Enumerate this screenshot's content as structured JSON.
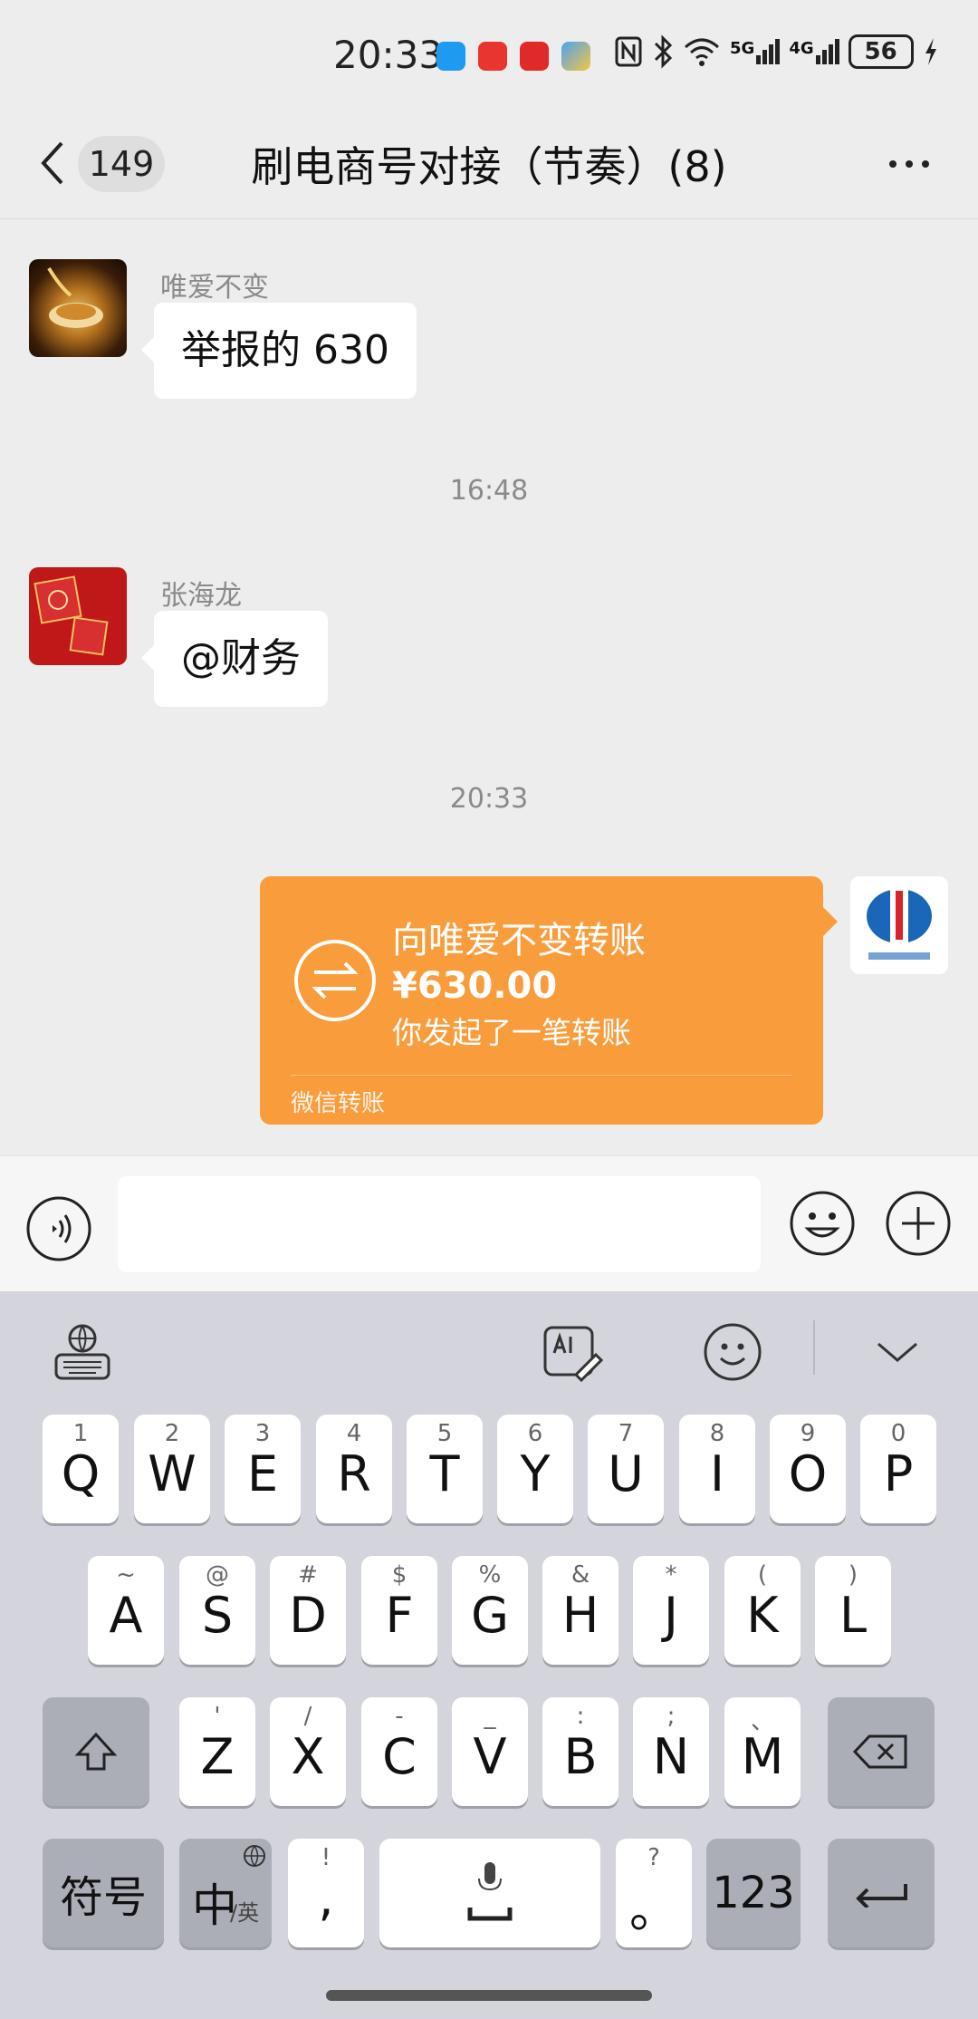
{
  "status_bar": {
    "time": "20:33",
    "battery": "56",
    "network_5g": "5G",
    "network_4g": "4G",
    "notification_icons": [
      "messages-icon",
      "huawei-store-icon",
      "app-icon",
      "app-icon"
    ]
  },
  "header": {
    "unread_count": "149",
    "title": "刷电商号对接（节奏）(8)"
  },
  "messages": [
    {
      "sender": "唯爱不变",
      "text": "举报的 630"
    },
    {
      "time": "16:48"
    },
    {
      "sender": "张海龙",
      "text": "@财务"
    },
    {
      "time": "20:33"
    }
  ],
  "transfer": {
    "title": "向唯爱不变转账",
    "amount": "¥630.00",
    "note": "你发起了一笔转账",
    "footer": "微信转账"
  },
  "input_bar": {
    "value": "",
    "placeholder": ""
  },
  "keyboard": {
    "row1": [
      {
        "sub": "1",
        "main": "Q"
      },
      {
        "sub": "2",
        "main": "W"
      },
      {
        "sub": "3",
        "main": "E"
      },
      {
        "sub": "4",
        "main": "R"
      },
      {
        "sub": "5",
        "main": "T"
      },
      {
        "sub": "6",
        "main": "Y"
      },
      {
        "sub": "7",
        "main": "U"
      },
      {
        "sub": "8",
        "main": "I"
      },
      {
        "sub": "9",
        "main": "O"
      },
      {
        "sub": "0",
        "main": "P"
      }
    ],
    "row2": [
      {
        "sub": "~",
        "main": "A"
      },
      {
        "sub": "@",
        "main": "S"
      },
      {
        "sub": "#",
        "main": "D"
      },
      {
        "sub": "$",
        "main": "F"
      },
      {
        "sub": "%",
        "main": "G"
      },
      {
        "sub": "&",
        "main": "H"
      },
      {
        "sub": "*",
        "main": "J"
      },
      {
        "sub": "(",
        "main": "K"
      },
      {
        "sub": ")",
        "main": "L"
      }
    ],
    "row3": [
      {
        "sub": "'",
        "main": "Z"
      },
      {
        "sub": "/",
        "main": "X"
      },
      {
        "sub": "-",
        "main": "C"
      },
      {
        "sub": "_",
        "main": "V"
      },
      {
        "sub": ":",
        "main": "B"
      },
      {
        "sub": ";",
        "main": "N"
      },
      {
        "sub": "、",
        "main": "M"
      }
    ],
    "symbols_label": "符号",
    "lang_main": "中",
    "lang_sub": "/英",
    "comma_sub": "!",
    "comma_main": ",",
    "period_sub": "?",
    "period_main": "。",
    "numbers_label": "123"
  },
  "colors": {
    "transfer_orange": "#f99c3b",
    "chat_background": "#ededed",
    "keyboard_background": "#d4d5dc"
  }
}
